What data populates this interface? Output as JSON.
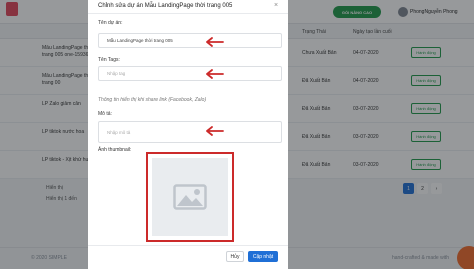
{
  "header": {
    "upgrade_label": "GÓI NÂNG CAO",
    "user_name": "PhongNguyễn Phong"
  },
  "table": {
    "columns": [
      "Trạng Thái",
      "Ngày tạo lần cuối"
    ],
    "rows": [
      {
        "name": "Mẫu LandingPage thời trang 005 one-1593658511",
        "status": "Chưa Xuất Bản",
        "date": "04-07-2020",
        "action": "Hành động"
      },
      {
        "name": "Mẫu LandingPage thời trang 00",
        "status": "Đã Xuất Bản",
        "date": "04-07-2020",
        "action": "Hành động"
      },
      {
        "name": "LP Zalo giảm cân",
        "status": "Đã Xuất Bản",
        "date": "03-07-2020",
        "action": "Hành động"
      },
      {
        "name": "LP tiktok nước hoa",
        "status": "Đã Xuất Bản",
        "date": "03-07-2020",
        "action": "Hành động"
      },
      {
        "name": "LP tiktok - Xịt khử hương",
        "status": "Đã Xuất Bản",
        "date": "03-07-2020",
        "action": "Hành động"
      }
    ]
  },
  "pagination": {
    "show_label": "Hiển thị",
    "show_label2": "Hiển thị 1 đến",
    "pages": [
      "1",
      "2"
    ],
    "next": "›"
  },
  "footer": {
    "left": "© 2020 SIMPLE",
    "right": "hand-crafted & made with"
  },
  "modal": {
    "title": "Chỉnh sửa dự án Mẫu LandingPage thời trang 005",
    "close": "×",
    "name_label": "Tên dự án:",
    "name_value": "Mẫu LandingPage thời trang 005",
    "tags_label": "Tên Tags:",
    "tags_placeholder": "Nhập tag",
    "share_info": "Thông tin hiển thị khi share link (Facebook, Zalo)",
    "desc_label": "Mô tả:",
    "desc_placeholder": "Nhập mô tả",
    "thumb_label": "Ảnh thumbnail:",
    "cancel_label": "Hủy",
    "save_label": "Cập nhật"
  },
  "colors": {
    "accent_green": "#1f9a4a",
    "accent_blue": "#1f6fd6",
    "highlight_red": "#cc2a2a"
  }
}
